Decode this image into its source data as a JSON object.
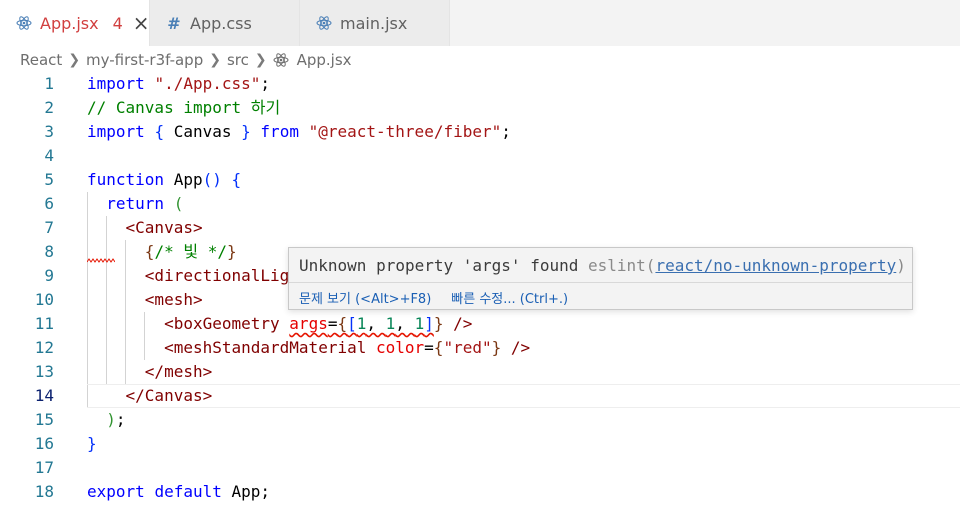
{
  "tabs": [
    {
      "icon": "react-icon",
      "label": "App.jsx",
      "badge": "4",
      "active": true,
      "close": "×"
    },
    {
      "icon": "hash-icon",
      "label": "App.css",
      "active": false
    },
    {
      "icon": "react-icon",
      "label": "main.jsx",
      "active": false
    }
  ],
  "hash_symbol": "#",
  "breadcrumb": {
    "items": [
      "React",
      "my-first-r3f-app",
      "src",
      "App.jsx"
    ]
  },
  "editor": {
    "current_line": 14,
    "lines": [
      {
        "n": "1",
        "tokens": [
          {
            "t": "import",
            "c": "kw"
          },
          {
            "t": " ",
            "c": "txt"
          },
          {
            "t": "\"./App.css\"",
            "c": "str"
          },
          {
            "t": ";",
            "c": "txt"
          }
        ]
      },
      {
        "n": "2",
        "tokens": [
          {
            "t": "// Canvas import 하기",
            "c": "cm"
          }
        ]
      },
      {
        "n": "3",
        "tokens": [
          {
            "t": "import",
            "c": "kw"
          },
          {
            "t": " ",
            "c": "txt"
          },
          {
            "t": "{",
            "c": "p1"
          },
          {
            "t": " Canvas ",
            "c": "txt"
          },
          {
            "t": "}",
            "c": "p1"
          },
          {
            "t": " ",
            "c": "txt"
          },
          {
            "t": "from",
            "c": "kw"
          },
          {
            "t": " ",
            "c": "txt"
          },
          {
            "t": "\"@react-three/fiber\"",
            "c": "str"
          },
          {
            "t": ";",
            "c": "txt"
          }
        ]
      },
      {
        "n": "4",
        "tokens": []
      },
      {
        "n": "5",
        "tokens": [
          {
            "t": "function",
            "c": "kw"
          },
          {
            "t": " App",
            "c": "txt"
          },
          {
            "t": "()",
            "c": "p1"
          },
          {
            "t": " ",
            "c": "txt"
          },
          {
            "t": "{",
            "c": "p1"
          }
        ]
      },
      {
        "n": "6",
        "tokens": [
          {
            "t": "  ",
            "c": "txt"
          },
          {
            "t": "return",
            "c": "kw"
          },
          {
            "t": " ",
            "c": "txt"
          },
          {
            "t": "(",
            "c": "p2"
          }
        ]
      },
      {
        "n": "7",
        "tokens": [
          {
            "t": "    ",
            "c": "txt"
          },
          {
            "t": "<Canvas>",
            "c": "tag"
          }
        ]
      },
      {
        "n": "8",
        "tokens": [
          {
            "t": "      ",
            "c": "txt"
          },
          {
            "t": "{",
            "c": "p3"
          },
          {
            "t": "/* 빛 */",
            "c": "cm"
          },
          {
            "t": "}",
            "c": "p3"
          }
        ]
      },
      {
        "n": "9",
        "tokens": [
          {
            "t": "      ",
            "c": "txt"
          },
          {
            "t": "<directionalLig",
            "c": "tag"
          }
        ]
      },
      {
        "n": "10",
        "tokens": [
          {
            "t": "      ",
            "c": "txt"
          },
          {
            "t": "<mesh>",
            "c": "tag"
          }
        ]
      },
      {
        "n": "11",
        "tokens": [
          {
            "t": "        ",
            "c": "txt"
          },
          {
            "t": "<boxGeometry ",
            "c": "tag"
          },
          {
            "t": "args",
            "c": "attr",
            "sq": true
          },
          {
            "t": "=",
            "c": "txt",
            "sq": true
          },
          {
            "t": "{",
            "c": "p3",
            "sq": true
          },
          {
            "t": "[",
            "c": "p1",
            "sq": true
          },
          {
            "t": "1",
            "c": "num",
            "sq": true
          },
          {
            "t": ", ",
            "c": "txt",
            "sq": true
          },
          {
            "t": "1",
            "c": "num",
            "sq": true
          },
          {
            "t": ", ",
            "c": "txt",
            "sq": true
          },
          {
            "t": "1",
            "c": "num",
            "sq": true
          },
          {
            "t": "]",
            "c": "p1",
            "sq": true
          },
          {
            "t": "}",
            "c": "p3"
          },
          {
            "t": " />",
            "c": "tag"
          }
        ]
      },
      {
        "n": "12",
        "tokens": [
          {
            "t": "        ",
            "c": "txt"
          },
          {
            "t": "<meshStandardMaterial ",
            "c": "tag"
          },
          {
            "t": "color",
            "c": "attr"
          },
          {
            "t": "=",
            "c": "txt"
          },
          {
            "t": "{",
            "c": "p3"
          },
          {
            "t": "\"red\"",
            "c": "str"
          },
          {
            "t": "}",
            "c": "p3"
          },
          {
            "t": " />",
            "c": "tag"
          }
        ]
      },
      {
        "n": "13",
        "tokens": [
          {
            "t": "      ",
            "c": "txt"
          },
          {
            "t": "</mesh>",
            "c": "tag"
          }
        ]
      },
      {
        "n": "14",
        "tokens": [
          {
            "t": "    ",
            "c": "txt"
          },
          {
            "t": "</Canvas>",
            "c": "tag"
          }
        ]
      },
      {
        "n": "15",
        "tokens": [
          {
            "t": "  ",
            "c": "txt"
          },
          {
            "t": ")",
            "c": "p2"
          },
          {
            "t": ";",
            "c": "txt"
          }
        ]
      },
      {
        "n": "16",
        "tokens": [
          {
            "t": "}",
            "c": "p1"
          }
        ]
      },
      {
        "n": "17",
        "tokens": []
      },
      {
        "n": "18",
        "tokens": [
          {
            "t": "export",
            "c": "kw"
          },
          {
            "t": " ",
            "c": "txt"
          },
          {
            "t": "default",
            "c": "kw"
          },
          {
            "t": " App;",
            "c": "txt"
          }
        ]
      }
    ]
  },
  "hover": {
    "message": "Unknown property 'args' found",
    "source": "eslint",
    "open_paren": "(",
    "rule": "react/no-unknown-property",
    "close_paren": ")",
    "actions": [
      "문제 보기 (<Alt>+F8)",
      "빠른 수정... (Ctrl+.)"
    ]
  },
  "colors": {
    "keyword": "#0000ff",
    "string": "#a31515",
    "comment": "#008000",
    "tag": "#800000",
    "attribute": "#e50000",
    "number": "#098658",
    "line_number": "#237893",
    "error": "#e51400",
    "tab_active": "#d13f3f",
    "link": "#1a5fb4"
  }
}
